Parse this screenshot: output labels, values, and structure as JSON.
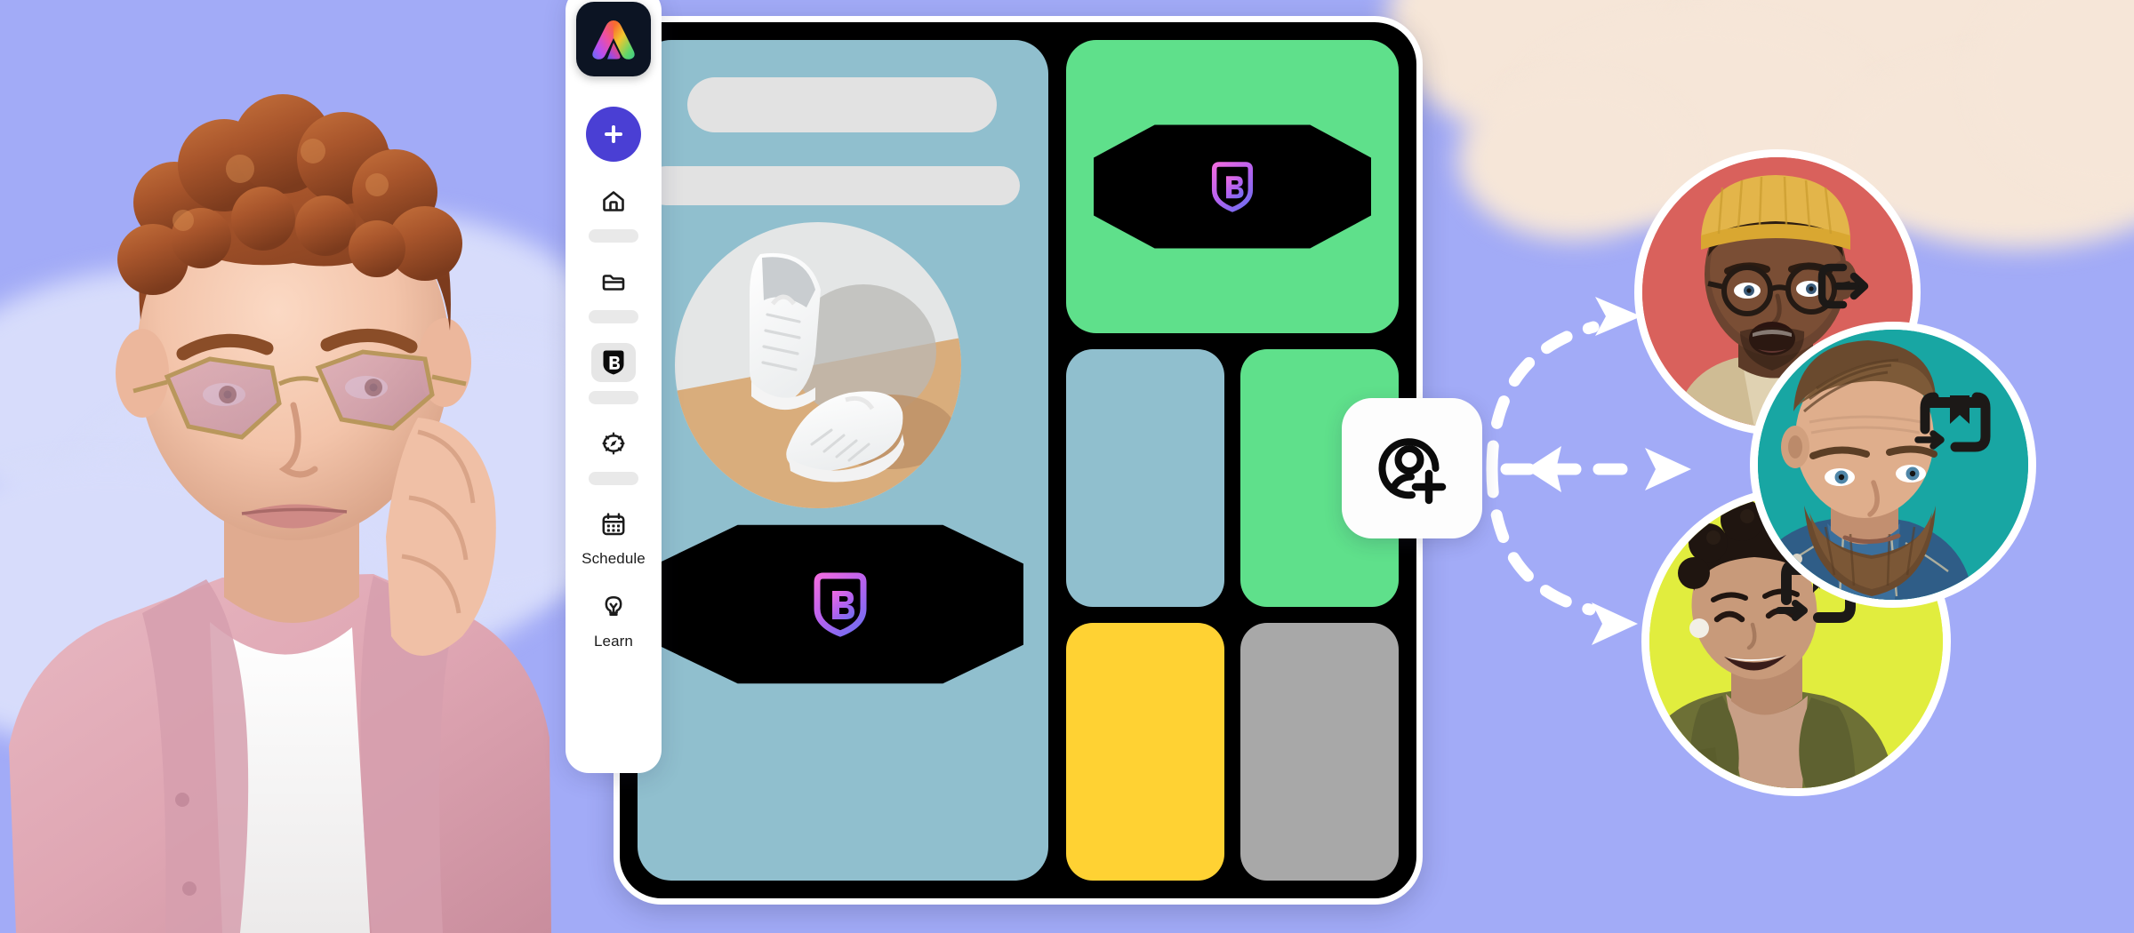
{
  "page": {
    "title": "Adobe Express brand collaboration hero",
    "background_color": "#a2abf7"
  },
  "sidebar": {
    "app_logo": {
      "name": "adobe-express-logo",
      "alt": "Adobe Express"
    },
    "create_button": {
      "label": "+",
      "aria": "Create new",
      "color": "#4a3fd4"
    },
    "items": [
      {
        "icon": "home-icon",
        "label": "",
        "label_placeholder": true,
        "active": false
      },
      {
        "icon": "folder-icon",
        "label": "",
        "label_placeholder": true,
        "active": false
      },
      {
        "icon": "brand-icon",
        "label": "",
        "label_placeholder": true,
        "active": true
      },
      {
        "icon": "compass-icon",
        "label": "",
        "label_placeholder": true,
        "active": false
      },
      {
        "icon": "calendar-icon",
        "label": "Schedule",
        "label_placeholder": false,
        "active": false
      },
      {
        "icon": "bulb-icon",
        "label": "Learn",
        "label_placeholder": false,
        "active": false
      }
    ]
  },
  "phone": {
    "frame_color": "#000000",
    "bezel_color": "#ffffff",
    "left_pane": {
      "background": "#90bfce",
      "skeleton_bars": 2,
      "product_photo": {
        "name": "white-sneakers-photo",
        "alt": "Pair of white sneakers on a two-tone backdrop"
      },
      "brand_badge": {
        "icon": "brand-shield-b-icon",
        "background": "#000000"
      }
    },
    "right_pane": {
      "hero_tile": {
        "background": "#5fe08b",
        "badge_icon": "brand-shield-b-icon",
        "badge_background": "#000000"
      },
      "tiles": [
        {
          "color": "#90bfce"
        },
        {
          "color": "#5fe08b"
        },
        {
          "color": "#ffd233"
        },
        {
          "color": "#a8a8a8"
        }
      ]
    }
  },
  "add_collaborator": {
    "icon": "add-person-icon",
    "aria": "Invite collaborator",
    "background": "#fdfdfd"
  },
  "connectors": {
    "style": "dashed",
    "color": "#ffffff",
    "arrow_count": 3
  },
  "collaborators": [
    {
      "id": "red",
      "background": "#d9615c",
      "icon": "logout-arrow-icon",
      "photo": "man-yellow-beanie-glasses-photo",
      "alt": "Man in yellow beanie with glasses, surprised expression"
    },
    {
      "id": "teal",
      "background": "#18a6a3",
      "icon": "save-bookmark-icon",
      "photo": "bearded-man-denim-photo",
      "alt": "Bearded man in denim jacket"
    },
    {
      "id": "lime",
      "background": "#e1ed3e",
      "icon": "save-bookmark-icon",
      "photo": "smiling-woman-olive-blazer-photo",
      "alt": "Smiling woman in olive blazer"
    }
  ],
  "person_left": {
    "name": "person-with-pink-glasses-photo",
    "alt": "Young person with curly red hair, pink tinted glasses and pink shirt resting chin on hand"
  },
  "sky": {
    "cloud_white": "#d7dcfb",
    "cloud_cream": "#f6e6d8"
  }
}
